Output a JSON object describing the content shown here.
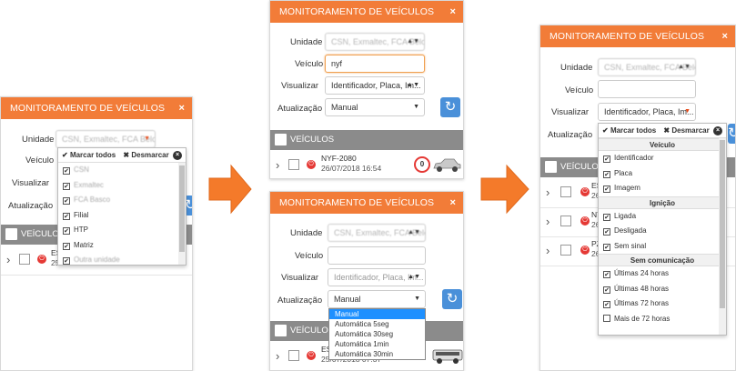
{
  "title": "MONITORAMENTO DE VEÍCULOS",
  "close": "×",
  "labels": {
    "unidade": "Unidade",
    "veiculo": "Veículo",
    "visualizar": "Visualizar",
    "atualizacao": "Atualização",
    "veiculos": "VEÍCULOS"
  },
  "fields": {
    "unidade_value": "CSN, Exmaltec, FCA Belo...",
    "visualizar_value": "Identificador, Placa, Im...",
    "atualizacao_value": "Manual",
    "veiculo_search": "nyf"
  },
  "dropdown": {
    "select_all": "Marcar todos",
    "deselect": "Desmarcar"
  },
  "unidade_options": [
    {
      "label": "CSN",
      "checked": true,
      "blur": true
    },
    {
      "label": "Exmaltec",
      "checked": true,
      "blur": true
    },
    {
      "label": "FCA Basco",
      "checked": true,
      "blur": true
    },
    {
      "label": "Filial",
      "checked": true,
      "blur": false
    },
    {
      "label": "HTP",
      "checked": true,
      "blur": false
    },
    {
      "label": "Matriz",
      "checked": true,
      "blur": false
    },
    {
      "label": "Outra unidade",
      "checked": true,
      "blur": true
    }
  ],
  "visualizar_groups": [
    {
      "title": "Veículo",
      "items": [
        {
          "label": "Identificador",
          "checked": true
        },
        {
          "label": "Placa",
          "checked": true
        },
        {
          "label": "Imagem",
          "checked": true
        }
      ]
    },
    {
      "title": "Ignição",
      "items": [
        {
          "label": "Ligada",
          "checked": true
        },
        {
          "label": "Desligada",
          "checked": true
        },
        {
          "label": "Sem sinal",
          "checked": true
        }
      ]
    },
    {
      "title": "Sem comunicação",
      "items": [
        {
          "label": "Últimas 24 horas",
          "checked": true
        },
        {
          "label": "Últimas 48 horas",
          "checked": true
        },
        {
          "label": "Últimas 72 horas",
          "checked": true
        },
        {
          "label": "Mais de 72 horas",
          "checked": false
        }
      ]
    }
  ],
  "atualizacao_options": [
    {
      "label": "Manual",
      "highlight": true
    },
    {
      "label": "Automática 5seg",
      "highlight": false
    },
    {
      "label": "Automática 30seg",
      "highlight": false
    },
    {
      "label": "Automática 1min",
      "highlight": false
    },
    {
      "label": "Automática 30min",
      "highlight": false
    }
  ],
  "vehicles": {
    "p1": {
      "id": "ES",
      "date": "25/07/2018 07:37"
    },
    "p2": {
      "id": "NYF-2080",
      "date": "26/07/2018 16:54",
      "speed": "0"
    },
    "p3": {
      "id": "ES",
      "date": "25/07/2018 07:37"
    },
    "p4": [
      {
        "id": "ES",
        "date": "26"
      },
      {
        "id": "NY",
        "date": "26"
      },
      {
        "id": "PZ",
        "date": "26"
      }
    ]
  },
  "colors": {
    "header": "#f27c38",
    "bar": "#8b8b8b",
    "accent": "#1e90ff",
    "arrow": "#f47a2a"
  }
}
